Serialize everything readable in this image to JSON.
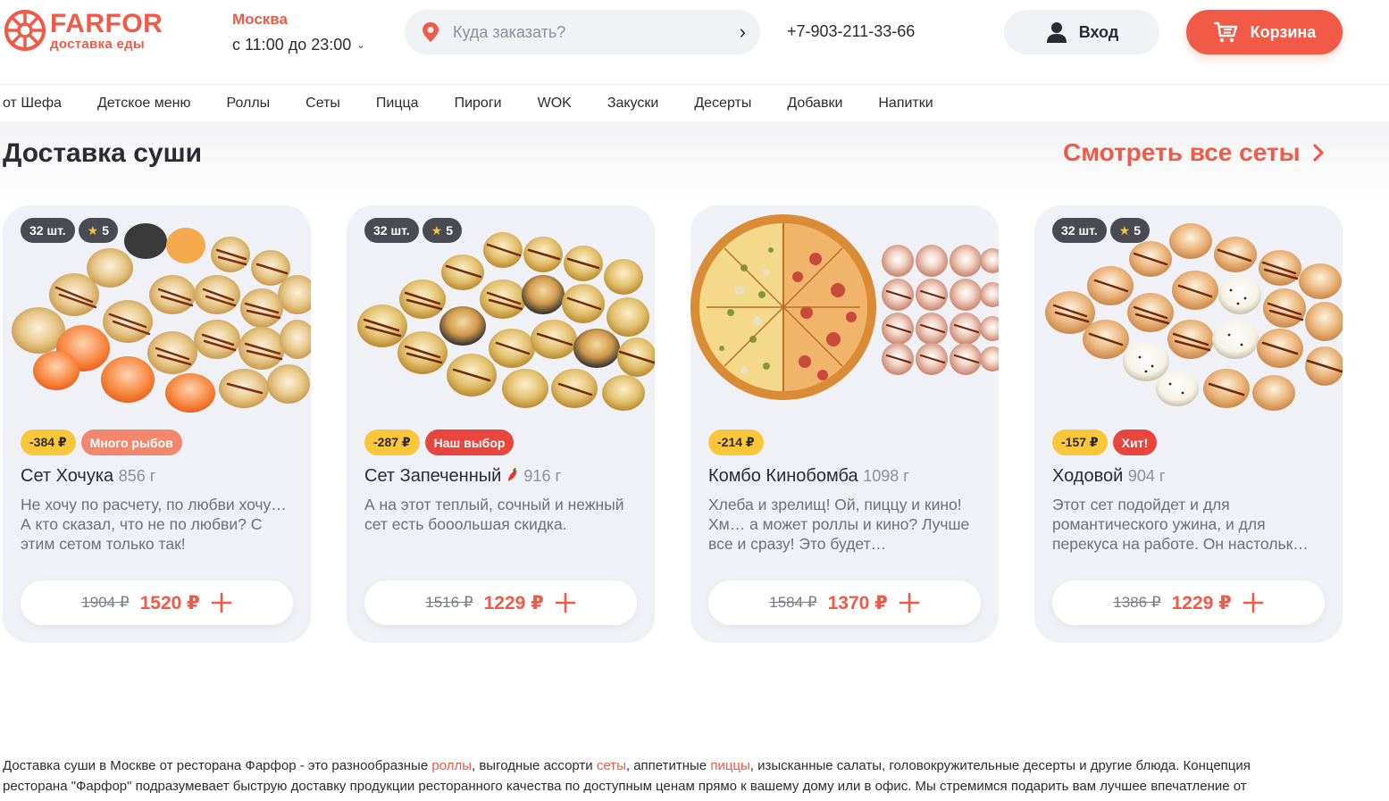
{
  "header": {
    "logo": {
      "name": "FARFOR",
      "subtitle": "доставка еды"
    },
    "city": "Москва",
    "work_hours": "с 11:00 до 23:00",
    "search": {
      "placeholder": "Куда заказать?"
    },
    "phone": "+7-903-211-33-66",
    "login_label": "Вход",
    "cart_label": "Корзина",
    "brand_color": "#f05a46"
  },
  "nav": {
    "items": [
      "от Шефа",
      "Детское меню",
      "Роллы",
      "Сеты",
      "Пицца",
      "Пироги",
      "WOK",
      "Закуски",
      "Десерты",
      "Добавки",
      "Напитки"
    ]
  },
  "section": {
    "title": "Доставка суши",
    "see_all": "Смотреть все сеты"
  },
  "products": [
    {
      "qty": "32 шт.",
      "rating": "5",
      "discount": "-384 ₽",
      "label": "Много рыбов",
      "label_color": "#f2876e",
      "name": "Сет Хочука",
      "weight": "856 г",
      "description": "Не хочу по расчету, по любви хочу… А кто сказал, что не по любви? С этим сетом только так!",
      "old_price": "1904 ₽",
      "price": "1520 ₽",
      "image": "sushi-set-salmon"
    },
    {
      "qty": "32 шт.",
      "rating": "5",
      "discount": "-287 ₽",
      "label": "Наш выбор",
      "label_color": "#e8453c",
      "name": "Сет Запеченный",
      "weight": "916 г",
      "spicy": true,
      "description": "А на этот теплый, сочный и нежный сет есть бооольшая скидка.",
      "old_price": "1516 ₽",
      "price": "1229 ₽",
      "image": "sushi-set-baked"
    },
    {
      "discount": "-214 ₽",
      "name": "Комбо Кинобомба",
      "weight": "1098 г",
      "description": "Хлеба и зрелищ! Ой, пиццу и кино! Хм… а может роллы и кино? Лучше все и сразу! Это будет…",
      "old_price": "1584 ₽",
      "price": "1370 ₽",
      "image": "pizza-rolls-combo"
    },
    {
      "qty": "32 шт.",
      "rating": "5",
      "discount": "-157 ₽",
      "label": "Хит!",
      "label_color": "#e8453c",
      "name": "Ходовой",
      "weight": "904 г",
      "description": "Этот сет подойдет и для романтического ужина, и для перекуса на работе. Он настольк…",
      "old_price": "1386 ₽",
      "price": "1229 ₽",
      "image": "sushi-set-mixed"
    }
  ],
  "seo": {
    "line1_a": "Доставка суши в Москве от ресторана Фарфор - это разнообразные ",
    "link_rolls": "роллы",
    "line1_b": ", выгодные ассорти ",
    "link_sets": "сеты",
    "line1_c": ", аппетитные ",
    "link_pizza": "пиццы",
    "line1_d": ", изысканные салаты, головокружительные десерты и другие блюда. Концепция",
    "line2": "ресторана \"Фарфор\" подразумевает быструю доставку продукции ресторанного качества по доступным ценам прямо к вашему дому или в офис. Мы стремимся подарить вам лучшее впечатление от"
  }
}
